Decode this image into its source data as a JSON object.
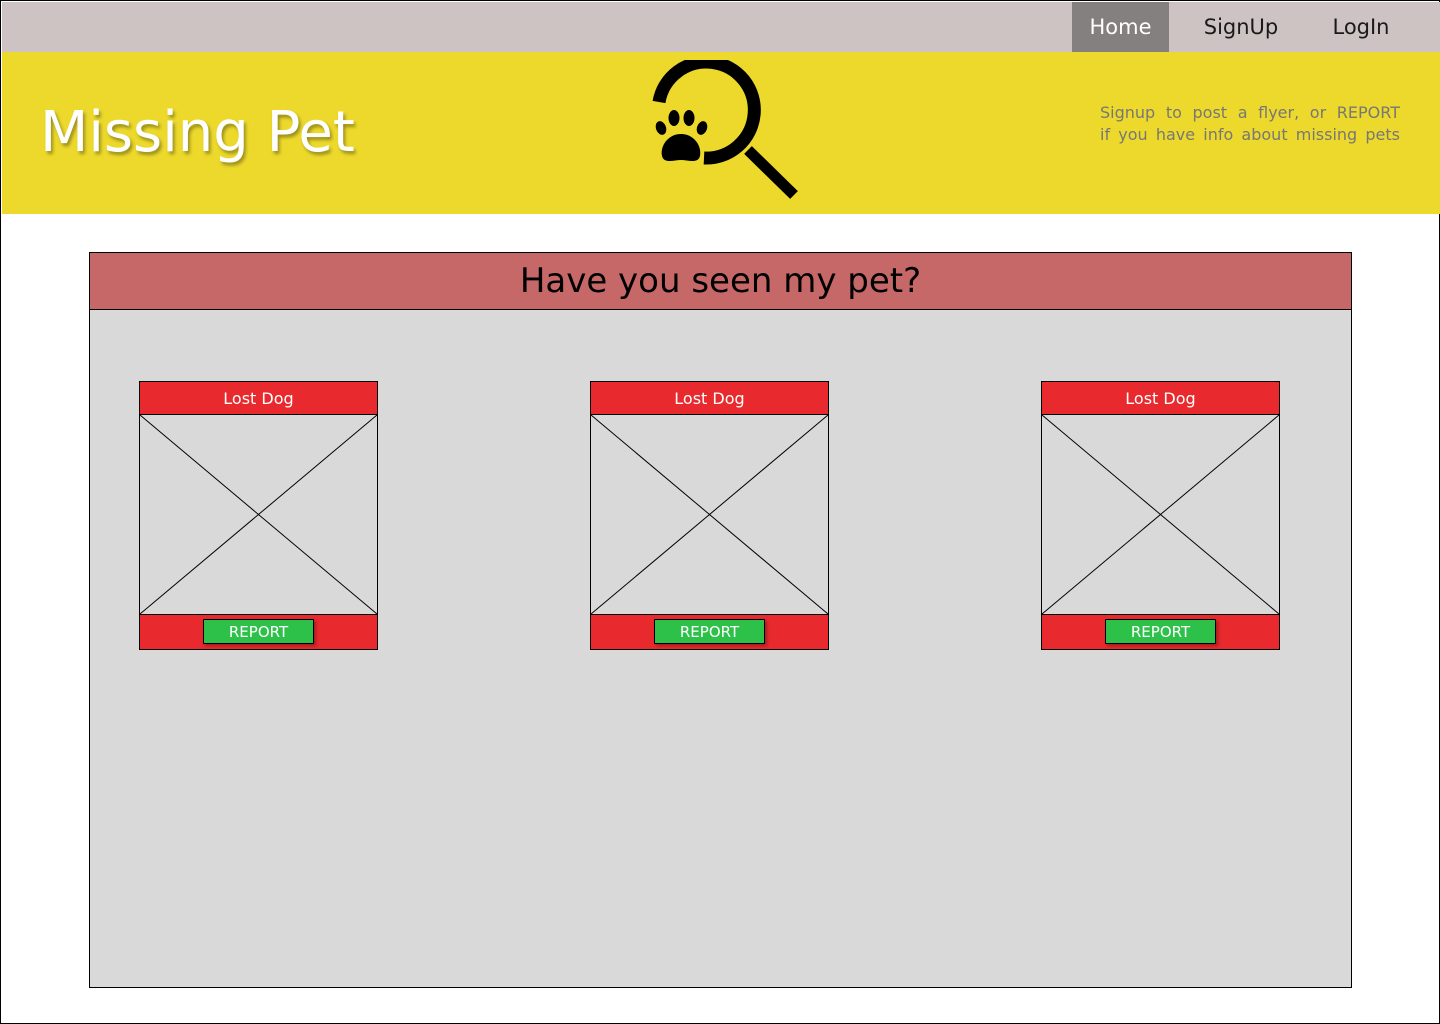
{
  "nav": {
    "home": "Home",
    "signup": "SignUp",
    "login": "LogIn",
    "active_bg": "#858080"
  },
  "banner": {
    "title": "Missing Pet",
    "tagline_line1": "Signup to post a flyer, or REPORT",
    "tagline_line2": "if you have info about missing pets",
    "logo_icon": "paw-magnifier-icon",
    "bg": "#ecd92b"
  },
  "main": {
    "heading": "Have you seen my pet?",
    "cards": [
      {
        "title": "Lost Dog",
        "button": "REPORT"
      },
      {
        "title": "Lost Dog",
        "button": "REPORT"
      },
      {
        "title": "Lost Dog",
        "button": "REPORT"
      }
    ]
  },
  "colors": {
    "nav_bg": "#cdc3c2",
    "panel_header": "#c66868",
    "card_red": "#e8292d",
    "report_green": "#2ec14a",
    "panel_bg": "#d9d9d9"
  }
}
